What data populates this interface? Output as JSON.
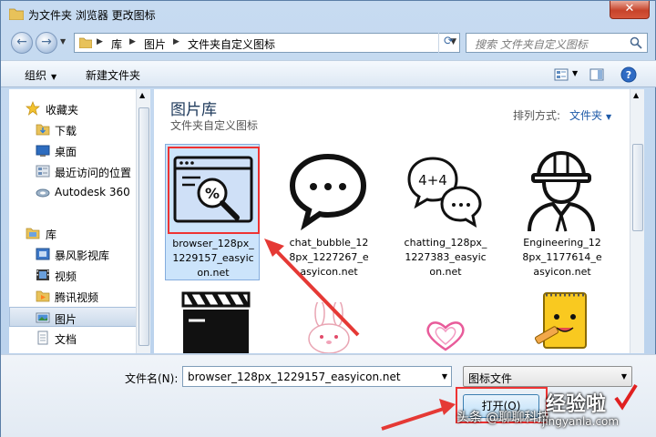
{
  "window": {
    "title": "为文件夹 浏览器 更改图标",
    "close_label": "✕"
  },
  "address": {
    "crumbs": [
      "库",
      "图片",
      "文件夹自定义图标"
    ],
    "search_placeholder": "搜索 文件夹自定义图标"
  },
  "toolbar": {
    "organize_label": "组织",
    "new_folder_label": "新建文件夹"
  },
  "sidebar": {
    "items": [
      {
        "label": "收藏夹",
        "icon": "star-icon"
      },
      {
        "label": "下载",
        "icon": "downloads-folder-icon"
      },
      {
        "label": "桌面",
        "icon": "desktop-icon"
      },
      {
        "label": "最近访问的位置",
        "icon": "recent-places-icon"
      },
      {
        "label": "Autodesk 360",
        "icon": "cloud-icon"
      },
      {
        "label": "库",
        "icon": "libraries-icon"
      },
      {
        "label": "暴风影视库",
        "icon": "video-library-icon"
      },
      {
        "label": "视频",
        "icon": "videos-icon"
      },
      {
        "label": "腾讯视频",
        "icon": "tencent-video-icon"
      },
      {
        "label": "图片",
        "icon": "pictures-icon"
      },
      {
        "label": "文档",
        "icon": "documents-icon"
      }
    ]
  },
  "library": {
    "title": "图片库",
    "subtitle": "文件夹自定义图标",
    "arrange_label": "排列方式:",
    "arrange_value": "文件夹"
  },
  "files": [
    {
      "name": "browser_128px_1229157_easyicon.net",
      "icon": "browser-search-icon"
    },
    {
      "name": "chat_bubble_128px_1227267_easyicon.net",
      "icon": "chat-bubble-icon"
    },
    {
      "name": "chatting_128px_1227383_easyicon.net",
      "icon": "chatting-icon"
    },
    {
      "name": "Engineering_128px_1177614_easyicon.net",
      "icon": "engineer-icon"
    },
    {
      "name": "",
      "icon": "clapperboard-icon"
    },
    {
      "name": "",
      "icon": "bunny-icon"
    },
    {
      "name": "",
      "icon": "heart-icon"
    },
    {
      "name": "",
      "icon": "notepad-character-icon"
    }
  ],
  "labels_wrapped": [
    [
      "browser_128px_",
      "1229157_easyic",
      "on.net"
    ],
    [
      "chat_bubble_12",
      "8px_1227267_e",
      "asyicon.net"
    ],
    [
      "chatting_128px_",
      "1227383_easyic",
      "on.net"
    ],
    [
      "Engineering_12",
      "8px_1177614_e",
      "asyicon.net"
    ]
  ],
  "footer": {
    "filename_label": "文件名(N):",
    "filename_value": "browser_128px_1229157_easyicon.net",
    "filetype_value": "图标文件",
    "open_label": "打开(O)"
  },
  "watermark": {
    "line1": "头条 @聊聊科技",
    "line2": "经验啦",
    "line3": "jingyanla.com",
    "check_color": "#e02020"
  },
  "colors": {
    "highlight_red": "#ee3333",
    "arrow_red": "#e53935",
    "selection_blue": "#cce4fb"
  }
}
